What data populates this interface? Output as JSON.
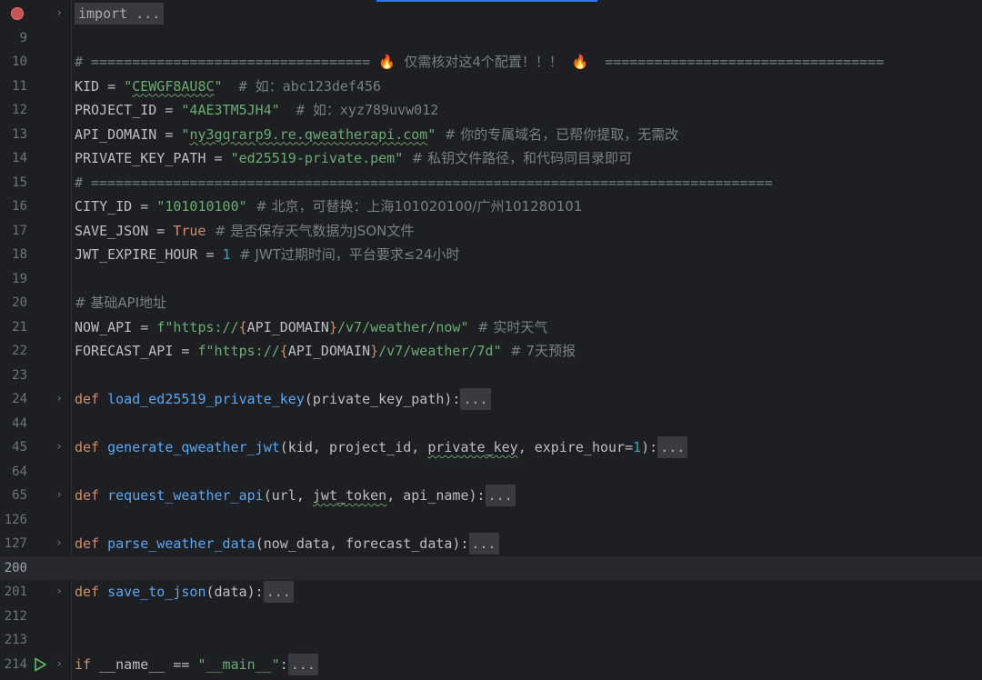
{
  "editor": {
    "lines": [
      {
        "num": "",
        "fold": "›",
        "tokens": [
          {
            "t": "import ...",
            "c": "import-box"
          }
        ]
      },
      {
        "num": "9",
        "tokens": []
      },
      {
        "num": "10",
        "tokens": [
          {
            "t": "# ================================== ",
            "c": "cmt"
          },
          {
            "t": "🔥",
            "c": "fire"
          },
          {
            "t": "  仅需核对这4个配置！！！  ",
            "c": "cmt cmt-cjk"
          },
          {
            "t": "🔥",
            "c": "fire"
          },
          {
            "t": "  ==================================",
            "c": "cmt"
          }
        ]
      },
      {
        "num": "11",
        "tokens": [
          {
            "t": "KID = ",
            "c": ""
          },
          {
            "t": "\"",
            "c": "str"
          },
          {
            "t": "CEWGF8AU8C",
            "c": "str typo"
          },
          {
            "t": "\"",
            "c": "str"
          },
          {
            "t": "  # 如：abc123def456",
            "c": "cmt"
          }
        ]
      },
      {
        "num": "12",
        "tokens": [
          {
            "t": "PROJECT_ID = ",
            "c": ""
          },
          {
            "t": "\"4AE3TM5JH4\"",
            "c": "str"
          },
          {
            "t": "  # 如：xyz789uvw012",
            "c": "cmt"
          }
        ]
      },
      {
        "num": "13",
        "tokens": [
          {
            "t": "API_DOMAIN = ",
            "c": ""
          },
          {
            "t": "\"",
            "c": "str"
          },
          {
            "t": "ny3gqrarp9.re.qweatherapi.com",
            "c": "str typo"
          },
          {
            "t": "\"",
            "c": "str"
          },
          {
            "t": "  # 你的专属域名，已帮你提取，无需改",
            "c": "cmt cmt-cjk"
          }
        ]
      },
      {
        "num": "14",
        "tokens": [
          {
            "t": "PRIVATE_KEY_PATH = ",
            "c": ""
          },
          {
            "t": "\"ed25519-private.pem\"",
            "c": "str"
          },
          {
            "t": "  # 私钥文件路径，和代码同目录即可",
            "c": "cmt cmt-cjk"
          }
        ]
      },
      {
        "num": "15",
        "tokens": [
          {
            "t": "# ===================================================================================",
            "c": "cmt"
          }
        ]
      },
      {
        "num": "16",
        "tokens": [
          {
            "t": "CITY_ID = ",
            "c": ""
          },
          {
            "t": "\"101010100\"",
            "c": "str"
          },
          {
            "t": "  # 北京，可替换：上海101020100/广州101280101",
            "c": "cmt cmt-cjk"
          }
        ]
      },
      {
        "num": "17",
        "tokens": [
          {
            "t": "SAVE_JSON = ",
            "c": ""
          },
          {
            "t": "True",
            "c": "kw"
          },
          {
            "t": "  # 是否保存天气数据为JSON文件",
            "c": "cmt cmt-cjk"
          }
        ]
      },
      {
        "num": "18",
        "tokens": [
          {
            "t": "JWT_EXPIRE_HOUR = ",
            "c": ""
          },
          {
            "t": "1",
            "c": "num"
          },
          {
            "t": "  # JWT过期时间，平台要求≤24小时",
            "c": "cmt cmt-cjk"
          }
        ]
      },
      {
        "num": "19",
        "tokens": []
      },
      {
        "num": "20",
        "tokens": [
          {
            "t": "# 基础API地址",
            "c": "cmt cmt-cjk"
          }
        ]
      },
      {
        "num": "21",
        "tokens": [
          {
            "t": "NOW_API = ",
            "c": ""
          },
          {
            "t": "f\"https://",
            "c": "str"
          },
          {
            "t": "{",
            "c": "brace"
          },
          {
            "t": "API_DOMAIN",
            "c": ""
          },
          {
            "t": "}",
            "c": "brace"
          },
          {
            "t": "/v7/weather/now\"",
            "c": "str"
          },
          {
            "t": "  # 实时天气",
            "c": "cmt cmt-cjk"
          }
        ]
      },
      {
        "num": "22",
        "tokens": [
          {
            "t": "FORECAST_API = ",
            "c": ""
          },
          {
            "t": "f\"https://",
            "c": "str"
          },
          {
            "t": "{",
            "c": "brace"
          },
          {
            "t": "API_DOMAIN",
            "c": ""
          },
          {
            "t": "}",
            "c": "brace"
          },
          {
            "t": "/v7/weather/7d\"",
            "c": "str"
          },
          {
            "t": "  # 7天预报",
            "c": "cmt cmt-cjk"
          }
        ]
      },
      {
        "num": "23",
        "tokens": []
      },
      {
        "num": "24",
        "fold": "›",
        "tokens": [
          {
            "t": "def ",
            "c": "kw"
          },
          {
            "t": "load_ed25519_private_key",
            "c": "fn"
          },
          {
            "t": "(private_key_path):",
            "c": ""
          },
          {
            "t": "...",
            "c": "fold-box"
          }
        ]
      },
      {
        "num": "44",
        "tokens": []
      },
      {
        "num": "45",
        "fold": "›",
        "tokens": [
          {
            "t": "def ",
            "c": "kw"
          },
          {
            "t": "generate_qweather_jwt",
            "c": "fn"
          },
          {
            "t": "(kid, project_id, ",
            "c": ""
          },
          {
            "t": "private_key",
            "c": "typo"
          },
          {
            "t": ", expire_hour=",
            "c": ""
          },
          {
            "t": "1",
            "c": "num"
          },
          {
            "t": "):",
            "c": ""
          },
          {
            "t": "...",
            "c": "fold-box"
          }
        ]
      },
      {
        "num": "64",
        "tokens": []
      },
      {
        "num": "65",
        "fold": "›",
        "tokens": [
          {
            "t": "def ",
            "c": "kw"
          },
          {
            "t": "request_weather_api",
            "c": "fn"
          },
          {
            "t": "(url, ",
            "c": ""
          },
          {
            "t": "jwt_token",
            "c": "typo"
          },
          {
            "t": ", api_name):",
            "c": ""
          },
          {
            "t": "...",
            "c": "fold-box"
          }
        ]
      },
      {
        "num": "126",
        "tokens": []
      },
      {
        "num": "127",
        "fold": "›",
        "tokens": [
          {
            "t": "def ",
            "c": "kw"
          },
          {
            "t": "parse_weather_data",
            "c": "fn"
          },
          {
            "t": "(now_data, forecast_data):",
            "c": ""
          },
          {
            "t": "...",
            "c": "fold-box"
          }
        ]
      },
      {
        "num": "200",
        "current": true,
        "tokens": []
      },
      {
        "num": "201",
        "fold": "›",
        "tokens": [
          {
            "t": "def ",
            "c": "kw"
          },
          {
            "t": "save_to_json",
            "c": "fn"
          },
          {
            "t": "(data):",
            "c": ""
          },
          {
            "t": "...",
            "c": "fold-box"
          }
        ]
      },
      {
        "num": "212",
        "tokens": []
      },
      {
        "num": "213",
        "tokens": []
      },
      {
        "num": "214",
        "fold": "›",
        "run": true,
        "tokens": [
          {
            "t": "if ",
            "c": "kw"
          },
          {
            "t": "__name__ == ",
            "c": ""
          },
          {
            "t": "\"__main__\"",
            "c": "str"
          },
          {
            "t": ":",
            "c": ""
          },
          {
            "t": "...",
            "c": "fold-box"
          }
        ]
      }
    ]
  },
  "colors": {
    "background": "#1e1f22",
    "keyword": "#cf8e6d",
    "string": "#6aab73",
    "number": "#2aacb8",
    "function": "#56a8f5",
    "comment": "#7a7e85",
    "breakpoint": "#c75450",
    "run": "#5fb865"
  },
  "icons": {
    "breakpoint": "breakpoint-icon",
    "run": "run-icon",
    "fold": "fold-chevron-icon"
  }
}
